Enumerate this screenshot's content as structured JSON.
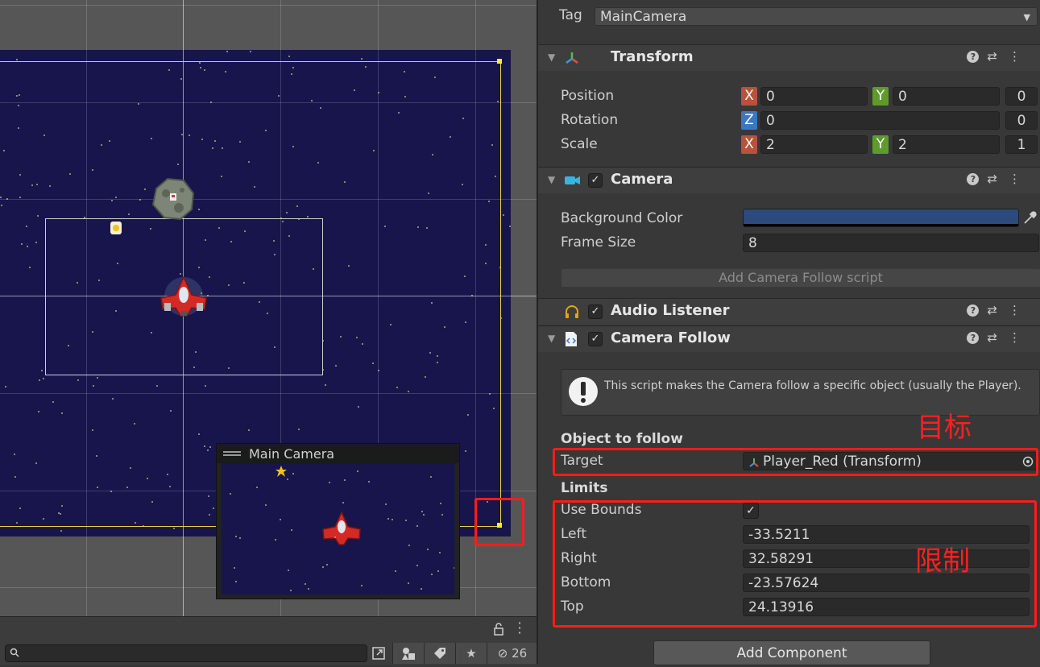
{
  "scene": {
    "preview_title": "Main Camera"
  },
  "toolbar": {
    "search_placeholder": "",
    "hidden_count": "26"
  },
  "inspector": {
    "tag_label": "Tag",
    "tag_value": "MainCamera",
    "transform": {
      "title": "Transform",
      "position_label": "Position",
      "rotation_label": "Rotation",
      "scale_label": "Scale",
      "position": {
        "x": "0",
        "y": "0",
        "extra": "0"
      },
      "rotation": {
        "z": "0",
        "extra": "0"
      },
      "scale": {
        "x": "2",
        "y": "2",
        "extra": "1"
      },
      "axis_x": "X",
      "axis_y": "Y",
      "axis_z": "Z"
    },
    "camera": {
      "title": "Camera",
      "bg_color_label": "Background Color",
      "bg_color": "#2c4a7c",
      "frame_size_label": "Frame Size",
      "frame_size": "8",
      "add_follow_button": "Add Camera Follow script"
    },
    "audio_listener": {
      "title": "Audio Listener"
    },
    "camera_follow": {
      "title": "Camera Follow",
      "info": "This script makes the Camera follow a specific object (usually the Player).",
      "object_to_follow_heading": "Object to follow",
      "target_label": "Target",
      "target_value": "Player_Red (Transform)",
      "limits_heading": "Limits",
      "use_bounds_label": "Use Bounds",
      "use_bounds_checked": "✓",
      "left_label": "Left",
      "left_value": "-33.5211",
      "right_label": "Right",
      "right_value": "32.58291",
      "bottom_label": "Bottom",
      "bottom_value": "-23.57624",
      "top_label": "Top",
      "top_value": "24.13916"
    },
    "add_component_button": "Add Component"
  },
  "annotations": {
    "target_note": "目标",
    "limits_note": "限制",
    "highlight_color": "#ff1c1c"
  },
  "colors": {
    "space_bg": "#17154c",
    "bounds_line": "#e6d33a",
    "axis_x": "#b8523b",
    "axis_y": "#5e9a2c",
    "axis_z": "#3b78c2"
  }
}
